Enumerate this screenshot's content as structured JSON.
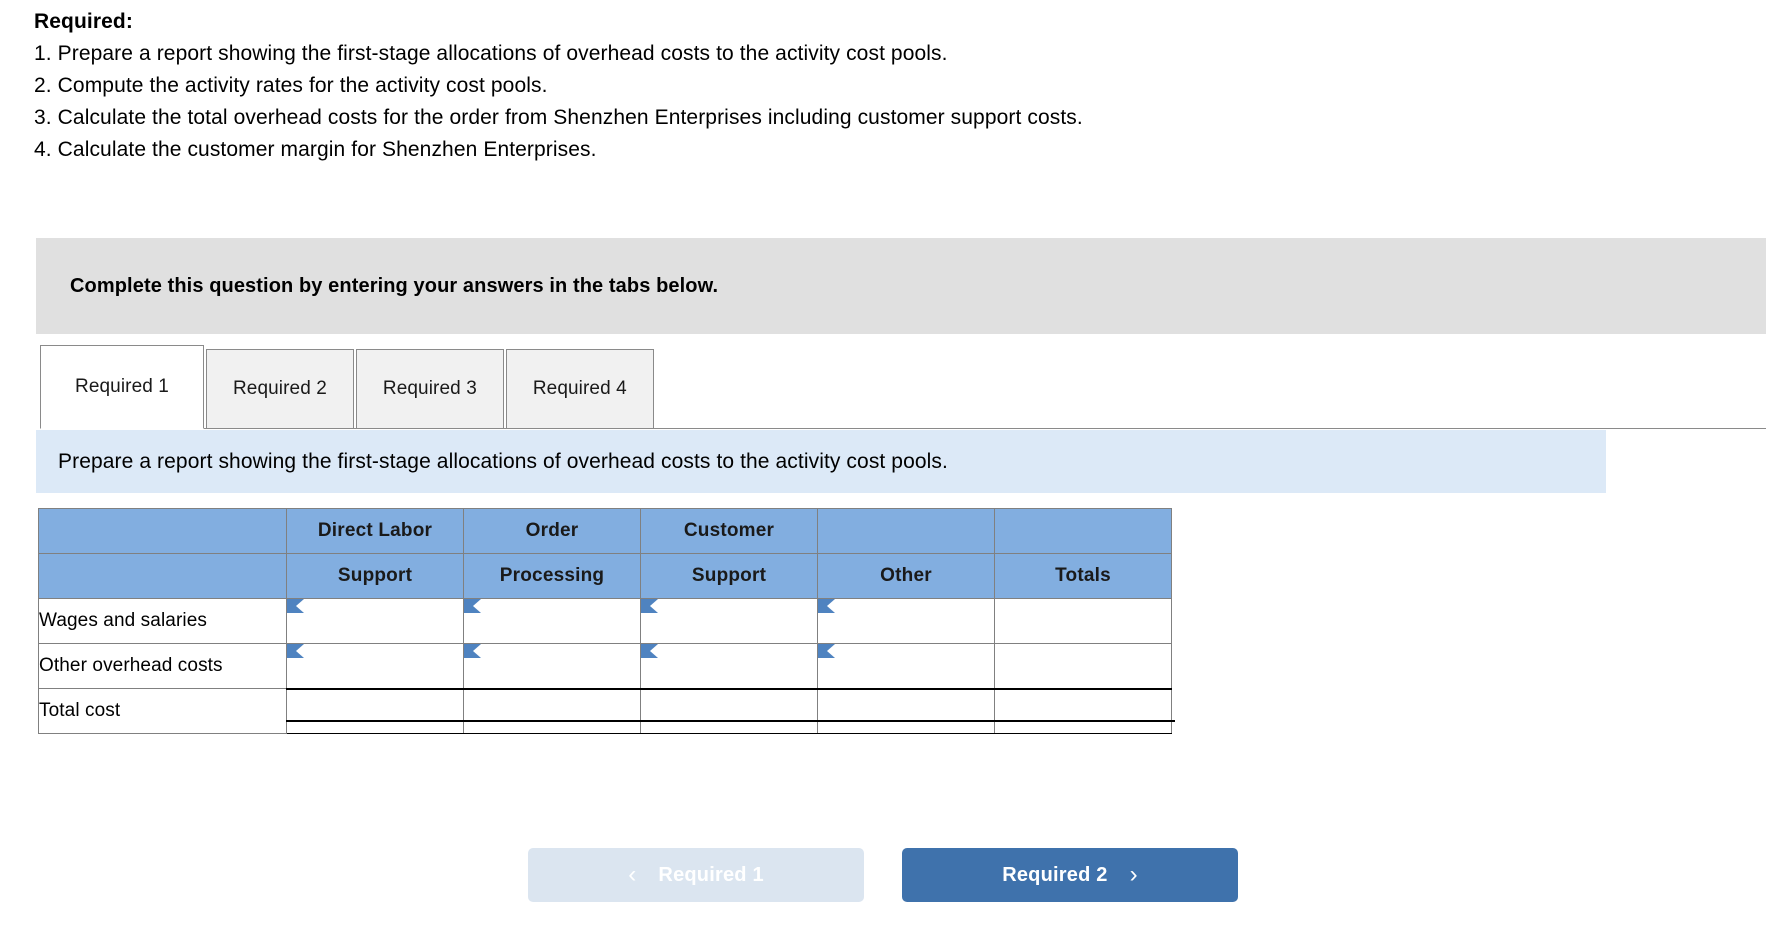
{
  "requirements": {
    "title": "Required:",
    "items": [
      "1. Prepare a report showing the first-stage allocations of overhead costs to the activity cost pools.",
      "2. Compute the activity rates for the activity cost pools.",
      "3. Calculate the total overhead costs for the order from Shenzhen Enterprises including customer support costs.",
      "4. Calculate the customer margin for Shenzhen Enterprises."
    ]
  },
  "banner": {
    "text": "Complete this question by entering your answers in the tabs below."
  },
  "tabs": [
    {
      "label": "Required 1",
      "active": true
    },
    {
      "label": "Required 2",
      "active": false
    },
    {
      "label": "Required 3",
      "active": false
    },
    {
      "label": "Required 4",
      "active": false
    }
  ],
  "instruction": {
    "text": "Prepare a report showing the first-stage allocations of overhead costs to the activity cost pools."
  },
  "table": {
    "header_row_1": [
      "",
      "Direct Labor",
      "Order",
      "Customer",
      "",
      ""
    ],
    "header_row_2": [
      "",
      "Support",
      "Processing",
      "Support",
      "Other",
      "Totals"
    ],
    "rows": [
      {
        "label": "Wages and salaries",
        "type": "input",
        "cells": [
          "",
          "",
          "",
          ""
        ],
        "total": ""
      },
      {
        "label": "Other overhead costs",
        "type": "input",
        "cells": [
          "",
          "",
          "",
          ""
        ],
        "total": ""
      },
      {
        "label": "Total cost",
        "type": "total",
        "cells": [
          "",
          "",
          "",
          ""
        ],
        "total": ""
      }
    ]
  },
  "nav": {
    "prev_label": "Required 1",
    "next_label": "Required 2",
    "prev_chevron": "chevron-left",
    "next_chevron": "chevron-right"
  },
  "colors": {
    "header_blue": "#82aee0",
    "instruction_blue": "#dce9f7",
    "banner_gray": "#e0e0e0",
    "next_button_blue": "#3f72ac",
    "prev_button_blue": "#dbe5f0",
    "input_border_blue": "#5b8fc9"
  }
}
